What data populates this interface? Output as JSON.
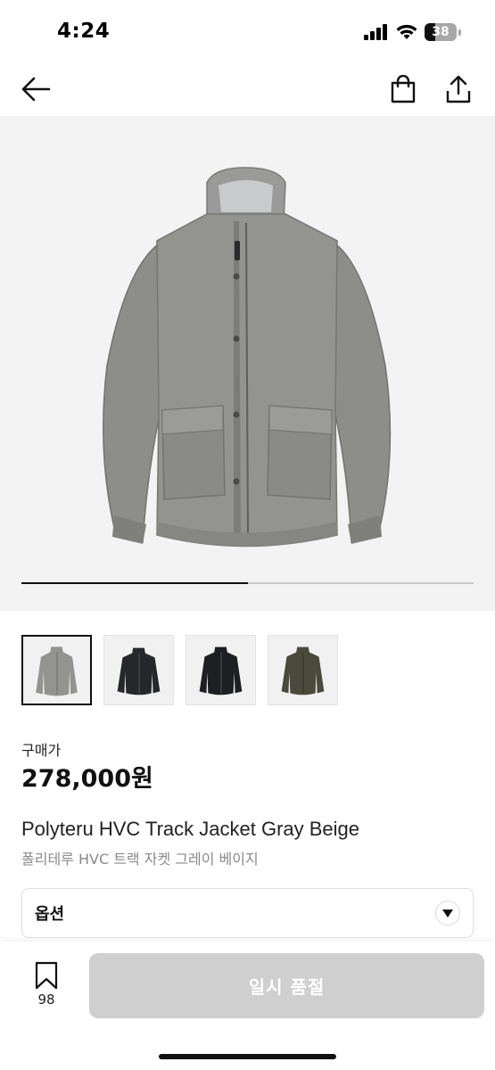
{
  "status_bar": {
    "time": "4:24",
    "battery": "38"
  },
  "nav": {
    "icons": [
      "back-arrow-icon",
      "shopping-bag-icon",
      "share-icon"
    ]
  },
  "hero": {
    "image": "gray-beige track jacket",
    "gallery_progress": 0.5
  },
  "thumbnails": [
    {
      "image": "gray jacket",
      "selected": true
    },
    {
      "image": "black jacket",
      "selected": false
    },
    {
      "image": "black jacket",
      "selected": false
    },
    {
      "image": "olive jacket",
      "selected": false
    }
  ],
  "price": {
    "label": "구매가",
    "value": "278,000원"
  },
  "product": {
    "name_en": "Polyteru HVC Track Jacket Gray Beige",
    "name_ko": "폴리테루 HVC 트랙 자켓 그레이 베이지"
  },
  "option": {
    "label": "옵션"
  },
  "bottom_bar": {
    "wishlist_count": "98",
    "buy_label": "일시 품절"
  },
  "colors": {
    "buy_disabled": "#cfcfcf",
    "hero_bg": "#f3f3f3",
    "jacket": "#8f8f8b"
  }
}
